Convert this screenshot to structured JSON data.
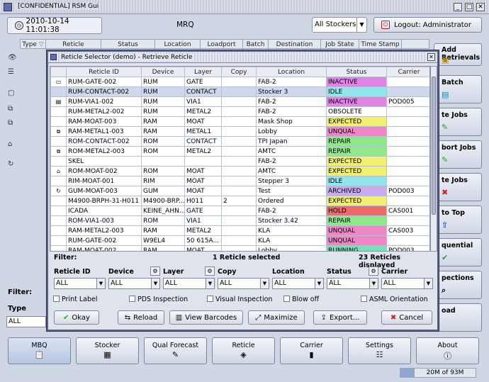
{
  "window": {
    "title": "[CONFIDENTIAL] RSM Gui"
  },
  "topbar": {
    "datetime": "2010-10-14 11:01:38",
    "center_label": "MRQ",
    "stocker_filter": "All Stockers",
    "logout_label": "Logout: Administrator"
  },
  "bg_table_headers": [
    "Type",
    "Reticle",
    "Status",
    "Location",
    "Loadport",
    "Batch",
    "Destination",
    "Job State",
    "Time Stamp"
  ],
  "bg_right_buttons": [
    {
      "label": "Add Retrievals"
    },
    {
      "label": "Batch"
    },
    {
      "label": "te Jobs"
    },
    {
      "label": "bort Jobs"
    },
    {
      "label": "te Jobs"
    },
    {
      "label": "to Top"
    },
    {
      "label": "quential"
    },
    {
      "label": "pections"
    },
    {
      "label": "oad"
    }
  ],
  "bg_left": {
    "filter_label": "Filter:",
    "type_label": "Type",
    "type_value": "ALL"
  },
  "dialog": {
    "title": "Reticle Selector (demo) - Retrieve Reticle",
    "columns": [
      "Reticle ID",
      "Device",
      "Layer",
      "Copy",
      "Location",
      "Status",
      "Carrier"
    ],
    "rows": [
      {
        "id": "RUM-GATE-002",
        "device": "RUM",
        "layer": "GATE",
        "copy": "",
        "location": "FAB-2",
        "status": "INACTIVE",
        "carrier": ""
      },
      {
        "id": "RUM-CONTACT-002",
        "device": "RUM",
        "layer": "CONTACT",
        "copy": "",
        "location": "Stocker 3",
        "status": "IDLE",
        "carrier": ""
      },
      {
        "id": "RUM-VIA1-002",
        "device": "RUM",
        "layer": "VIA1",
        "copy": "",
        "location": "FAB-2",
        "status": "INACTIVE",
        "carrier": "POD005"
      },
      {
        "id": "RUM-METAL2-002",
        "device": "RUM",
        "layer": "METAL2",
        "copy": "",
        "location": "FAB-2",
        "status": "OBSOLETE",
        "carrier": ""
      },
      {
        "id": "RAM-MOAT-003",
        "device": "RAM",
        "layer": "MOAT",
        "copy": "",
        "location": "Mask Shop",
        "status": "EXPECTED",
        "carrier": ""
      },
      {
        "id": "RAM-METAL1-003",
        "device": "RAM",
        "layer": "METAL1",
        "copy": "",
        "location": "Lobby",
        "status": "UNQUAL",
        "carrier": ""
      },
      {
        "id": "ROM-CONTACT-002",
        "device": "ROM",
        "layer": "CONTACT",
        "copy": "",
        "location": "TPI Japan",
        "status": "REPAIR",
        "carrier": ""
      },
      {
        "id": "ROM-METAL2-003",
        "device": "ROM",
        "layer": "METAL2",
        "copy": "",
        "location": "AMTC",
        "status": "REPAIR",
        "carrier": ""
      },
      {
        "id": "SKEL",
        "device": "",
        "layer": "",
        "copy": "",
        "location": "FAB-2",
        "status": "EXPECTED",
        "carrier": ""
      },
      {
        "id": "ROM-MOAT-002",
        "device": "ROM",
        "layer": "MOAT",
        "copy": "",
        "location": "AMTC",
        "status": "EXPECTED",
        "carrier": ""
      },
      {
        "id": "RIM-MOAT-001",
        "device": "RIM",
        "layer": "MOAT",
        "copy": "",
        "location": "Stepper 3",
        "status": "IDLE",
        "carrier": ""
      },
      {
        "id": "GUM-MOAT-003",
        "device": "GUM",
        "layer": "MOAT",
        "copy": "",
        "location": "Test",
        "status": "ARCHIVED",
        "carrier": "POD003"
      },
      {
        "id": "M4900-BRPH-31-H011",
        "device": "M4900-BRP...",
        "layer": "H011",
        "copy": "2",
        "location": "Ordered",
        "status": "EXPECTED",
        "carrier": ""
      },
      {
        "id": "ICADA",
        "device": "KEINE_AHN...",
        "layer": "GATE",
        "copy": "",
        "location": "FAB-2",
        "status": "HOLD",
        "carrier": "CAS001"
      },
      {
        "id": "ROM-VIA1-003",
        "device": "ROM",
        "layer": "VIA1",
        "copy": "",
        "location": "Stocker 3.42",
        "status": "REPAIR",
        "carrier": ""
      },
      {
        "id": "RAM-METAL2-003",
        "device": "RAM",
        "layer": "METAL2",
        "copy": "",
        "location": "KLA",
        "status": "UNQUAL",
        "carrier": "CAS003"
      },
      {
        "id": "RUM-GATE-002",
        "device": "W9EL4",
        "layer": "50 615A...",
        "copy": "",
        "location": "KLA",
        "status": "UNQUAL",
        "carrier": ""
      },
      {
        "id": "RAM-MOAT-002",
        "device": "RAM",
        "layer": "MOAT",
        "copy": "",
        "location": "Lobby",
        "status": "RUNNING",
        "carrier": "POD003"
      }
    ],
    "selected_row": 1,
    "status_colors": {
      "INACTIVE": "#e083e6",
      "IDLE": "#8fe6ee",
      "OBSOLETE": "#ffffff",
      "EXPECTED": "#f2ef6e",
      "UNQUAL": "#ee86c8",
      "REPAIR": "#8fe889",
      "ARCHIVED": "#c9a9ef",
      "HOLD": "#ef6b6b",
      "RUNNING": "#6ee6b4"
    },
    "summary": {
      "filter_label": "Filter:",
      "selected": "1 Reticle selected",
      "displayed": "23 Reticles displayed"
    },
    "filters": [
      {
        "label": "Reticle ID",
        "value": "ALL"
      },
      {
        "label": "Device",
        "value": "ALL"
      },
      {
        "label": "Layer",
        "value": "ALL"
      },
      {
        "label": "Copy",
        "value": "ALL"
      },
      {
        "label": "Location",
        "value": "ALL"
      },
      {
        "label": "Status",
        "value": "ALL"
      },
      {
        "label": "Carrier",
        "value": "ALL"
      }
    ],
    "checkboxes": [
      "Print Label",
      "PDS Inspection",
      "Visual Inspection",
      "Blow off",
      "ASML Orientation"
    ],
    "buttons": {
      "okay": "Okay",
      "reload": "Reload",
      "view_barcodes": "View Barcodes",
      "maximize": "Maximize",
      "export": "Export...",
      "cancel": "Cancel"
    }
  },
  "nav": [
    {
      "label": "MBQ",
      "icon": "clipboard-icon"
    },
    {
      "label": "Stocker",
      "icon": "stocker-icon"
    },
    {
      "label": "Qual Forecast",
      "icon": "forecast-icon"
    },
    {
      "label": "Reticle",
      "icon": "reticle-icon"
    },
    {
      "label": "Carrier",
      "icon": "carrier-icon"
    },
    {
      "label": "Settings",
      "icon": "settings-icon"
    },
    {
      "label": "About",
      "icon": "about-icon"
    }
  ],
  "status_bar": {
    "memory": "20M of 93M"
  }
}
